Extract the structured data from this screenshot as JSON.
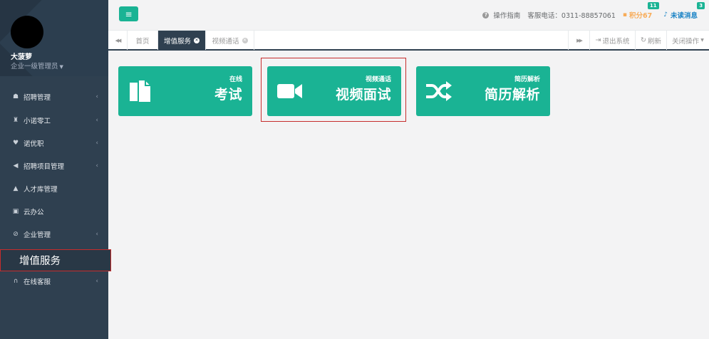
{
  "sidebar": {
    "user_name": "大菠萝",
    "user_role": "企业一级管理员",
    "items": [
      {
        "label": "招聘管理",
        "icon": "desktop-icon",
        "glyph": "☗",
        "arrow": "‹"
      },
      {
        "label": "小诺零工",
        "icon": "chess-icon",
        "glyph": "♜",
        "arrow": "‹"
      },
      {
        "label": "诺优职",
        "icon": "heart-icon",
        "glyph": "♥",
        "arrow": "‹"
      },
      {
        "label": "招聘项目管理",
        "icon": "bullhorn-icon",
        "glyph": "◀",
        "arrow": "‹"
      },
      {
        "label": "人才库管理",
        "icon": "graduation-cap-icon",
        "glyph": "▲",
        "arrow": ""
      },
      {
        "label": "云办公",
        "icon": "briefcase-icon",
        "glyph": "▣",
        "arrow": ""
      },
      {
        "label": "企业管理",
        "icon": "paperclip-icon",
        "glyph": "⊘",
        "arrow": "‹"
      },
      {
        "label": "增值服务",
        "icon": "",
        "glyph": "",
        "arrow": ""
      },
      {
        "label": "在线客服",
        "icon": "headphones-icon",
        "glyph": "∩",
        "arrow": "‹"
      }
    ]
  },
  "topbar": {
    "menu_glyph": "≡",
    "guide": "操作指南",
    "phone": "客服电话：0311-88857061",
    "points": "积分67",
    "points_badge": "11",
    "messages": "未读消息",
    "messages_badge": "3"
  },
  "tabs": {
    "back_glyph": "◀◀",
    "forward_glyph": "▶▶",
    "items": [
      "首页",
      "增值服务",
      "视频通话"
    ],
    "logout": "退出系统",
    "refresh": "刷新",
    "close_ops": "关闭操作"
  },
  "cards": [
    {
      "small": "在线",
      "big": "考试",
      "icon": "copy-icon"
    },
    {
      "small": "视频通话",
      "big": "视频面试",
      "icon": "video-camera-icon"
    },
    {
      "small": "简历解析",
      "big": "简历解析",
      "icon": "shuffle-icon"
    }
  ],
  "colors": {
    "accent": "#1ab394",
    "sidebar": "#2f4050",
    "highlight": "#c62d2d",
    "points": "#f8ac59",
    "messages": "#1c84c6"
  }
}
